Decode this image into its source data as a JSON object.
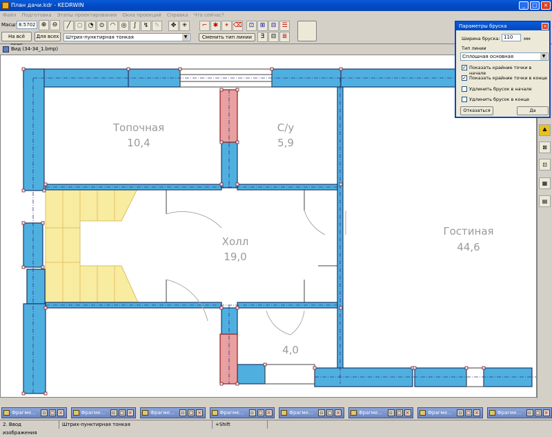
{
  "window": {
    "title": "План дачи.kdr - KEDRWIN"
  },
  "menu": [
    "Файл",
    "Подготовка",
    "Этапы проектирования",
    "Окна проекций",
    "Справка",
    "Что сейчас?"
  ],
  "toolbar": {
    "scale_label": "Масшт",
    "scale_value": "8.5702",
    "fit_all_button": "На всё окно",
    "for_all_button": "Для всех",
    "line_type_value": "Штрих-пунктирная тонкая",
    "change_line_type_button": "Сменить тип линии"
  },
  "document": {
    "title": "Вид (34-34_1.bmp)"
  },
  "plan": {
    "rooms": [
      {
        "name": "Топочная",
        "area": "10,4"
      },
      {
        "name": "С/у",
        "area": "5,9"
      },
      {
        "name": "Холл",
        "area": "19,0"
      },
      {
        "name": "Гостиная",
        "area": "44,6"
      },
      {
        "name": "",
        "area": "4,0"
      }
    ]
  },
  "dialog": {
    "title": "Параметры бруска",
    "width_label": "Ширина бруска:",
    "width_value": "110",
    "width_unit": "мм",
    "line_type_label": "Тип линии",
    "line_type_value": "Сплошная основная",
    "options": [
      {
        "label": "Показать крайние точки в начале",
        "checked": true
      },
      {
        "label": "Показать крайние точки в конце",
        "checked": true
      },
      {
        "label": "Удлинить брусок в начале",
        "checked": false
      },
      {
        "label": "Удлинить брусок в конце",
        "checked": false
      }
    ],
    "cancel_button": "Отказаться",
    "ok_button": "Да"
  },
  "taskbar": {
    "items": [
      "Фрагме...",
      "Фрагме...",
      "Фрагме...",
      "Фрагме...",
      "Фрагме...",
      "Фрагме...",
      "Фрагме...",
      "Фрагме..."
    ]
  },
  "status": {
    "mode": "2. Ввод изображения",
    "line_type": "Штрих-пунктирная тонкая",
    "modifier": "+Shift"
  }
}
